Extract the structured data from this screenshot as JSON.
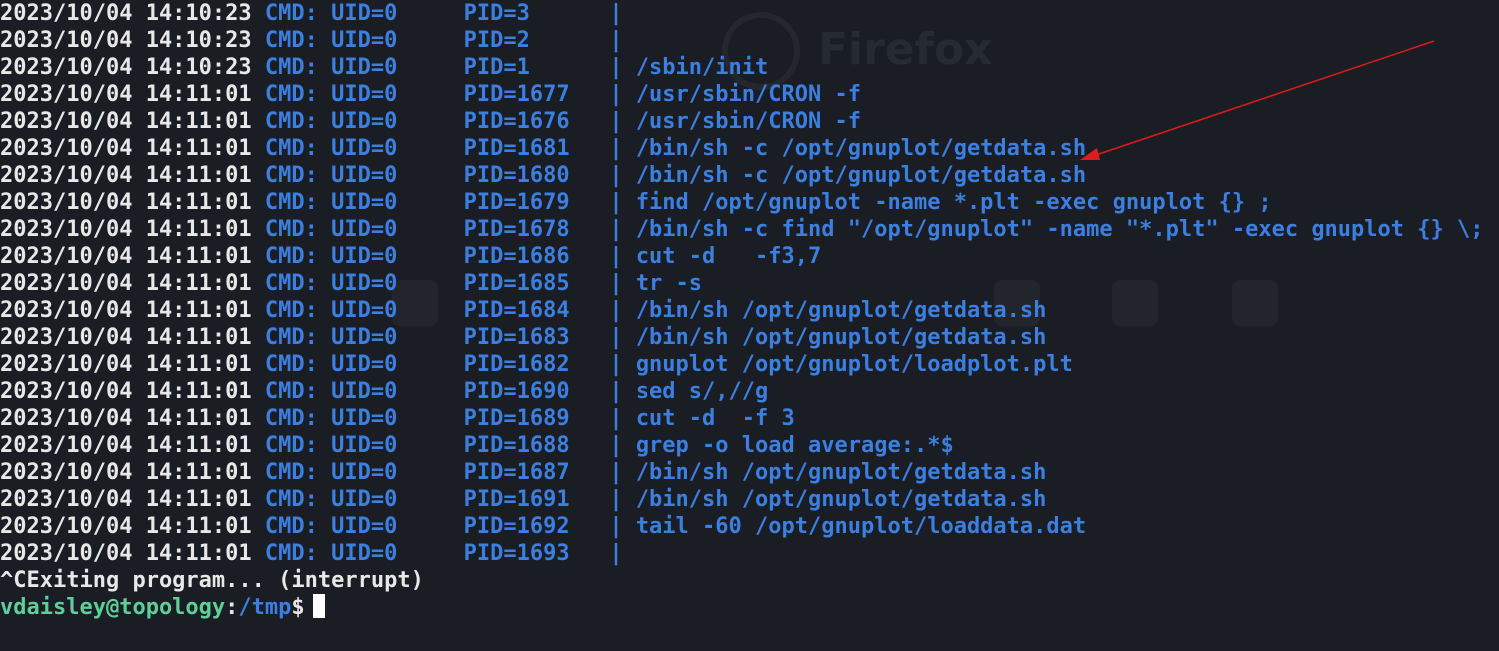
{
  "colors": {
    "background": "#1a1d23",
    "timestamp": "#e8e8e8",
    "command": "#3b7fe0",
    "prompt_user": "#5fcf9a",
    "prompt_path": "#3b7fe0",
    "annotation_arrow": "#e01b1b"
  },
  "background_ghost": {
    "logo_icon": "firefox-icon",
    "label": "Firefox"
  },
  "log": [
    {
      "ts": "2023/10/04 14:10:23",
      "uid": "CMD: UID=0",
      "pid": "PID=3",
      "cmd": ""
    },
    {
      "ts": "2023/10/04 14:10:23",
      "uid": "CMD: UID=0",
      "pid": "PID=2",
      "cmd": ""
    },
    {
      "ts": "2023/10/04 14:10:23",
      "uid": "CMD: UID=0",
      "pid": "PID=1",
      "cmd": "/sbin/init"
    },
    {
      "ts": "2023/10/04 14:11:01",
      "uid": "CMD: UID=0",
      "pid": "PID=1677",
      "cmd": "/usr/sbin/CRON -f"
    },
    {
      "ts": "2023/10/04 14:11:01",
      "uid": "CMD: UID=0",
      "pid": "PID=1676",
      "cmd": "/usr/sbin/CRON -f"
    },
    {
      "ts": "2023/10/04 14:11:01",
      "uid": "CMD: UID=0",
      "pid": "PID=1681",
      "cmd": "/bin/sh -c /opt/gnuplot/getdata.sh"
    },
    {
      "ts": "2023/10/04 14:11:01",
      "uid": "CMD: UID=0",
      "pid": "PID=1680",
      "cmd": "/bin/sh -c /opt/gnuplot/getdata.sh"
    },
    {
      "ts": "2023/10/04 14:11:01",
      "uid": "CMD: UID=0",
      "pid": "PID=1679",
      "cmd": "find /opt/gnuplot -name *.plt -exec gnuplot {} ;"
    },
    {
      "ts": "2023/10/04 14:11:01",
      "uid": "CMD: UID=0",
      "pid": "PID=1678",
      "cmd": "/bin/sh -c find \"/opt/gnuplot\" -name \"*.plt\" -exec gnuplot {} \\;"
    },
    {
      "ts": "2023/10/04 14:11:01",
      "uid": "CMD: UID=0",
      "pid": "PID=1686",
      "cmd": "cut -d   -f3,7"
    },
    {
      "ts": "2023/10/04 14:11:01",
      "uid": "CMD: UID=0",
      "pid": "PID=1685",
      "cmd": "tr -s"
    },
    {
      "ts": "2023/10/04 14:11:01",
      "uid": "CMD: UID=0",
      "pid": "PID=1684",
      "cmd": "/bin/sh /opt/gnuplot/getdata.sh"
    },
    {
      "ts": "2023/10/04 14:11:01",
      "uid": "CMD: UID=0",
      "pid": "PID=1683",
      "cmd": "/bin/sh /opt/gnuplot/getdata.sh"
    },
    {
      "ts": "2023/10/04 14:11:01",
      "uid": "CMD: UID=0",
      "pid": "PID=1682",
      "cmd": "gnuplot /opt/gnuplot/loadplot.plt"
    },
    {
      "ts": "2023/10/04 14:11:01",
      "uid": "CMD: UID=0",
      "pid": "PID=1690",
      "cmd": "sed s/,//g"
    },
    {
      "ts": "2023/10/04 14:11:01",
      "uid": "CMD: UID=0",
      "pid": "PID=1689",
      "cmd": "cut -d  -f 3"
    },
    {
      "ts": "2023/10/04 14:11:01",
      "uid": "CMD: UID=0",
      "pid": "PID=1688",
      "cmd": "grep -o load average:.*$"
    },
    {
      "ts": "2023/10/04 14:11:01",
      "uid": "CMD: UID=0",
      "pid": "PID=1687",
      "cmd": "/bin/sh /opt/gnuplot/getdata.sh"
    },
    {
      "ts": "2023/10/04 14:11:01",
      "uid": "CMD: UID=0",
      "pid": "PID=1691",
      "cmd": "/bin/sh /opt/gnuplot/getdata.sh"
    },
    {
      "ts": "2023/10/04 14:11:01",
      "uid": "CMD: UID=0",
      "pid": "PID=1692",
      "cmd": "tail -60 /opt/gnuplot/loaddata.dat"
    },
    {
      "ts": "2023/10/04 14:11:01",
      "uid": "CMD: UID=0",
      "pid": "PID=1693",
      "cmd": ""
    }
  ],
  "separator": "|",
  "interrupt_line": "^CExiting program... (interrupt)",
  "prompt": {
    "user_host": "vdaisley@topology",
    "colon": ":",
    "path": "/tmp",
    "sign": "$"
  }
}
